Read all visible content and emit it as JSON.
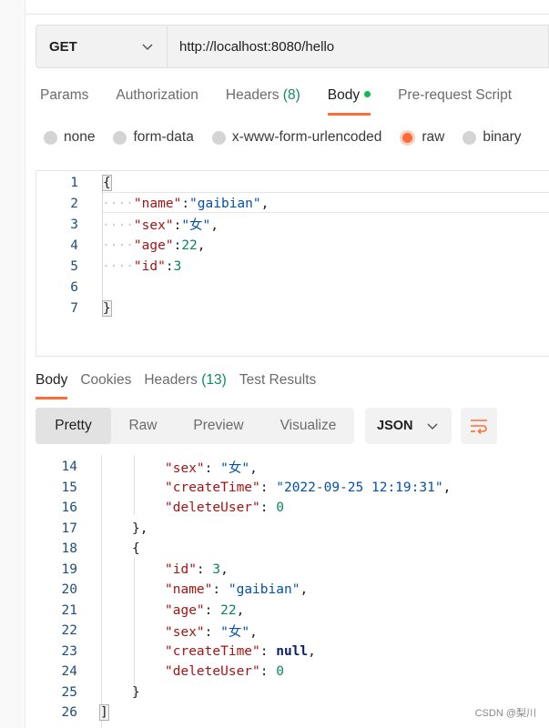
{
  "request": {
    "method": "GET",
    "url": "http://localhost:8080/hello"
  },
  "request_tabs": [
    {
      "label": "Params"
    },
    {
      "label": "Authorization"
    },
    {
      "label": "Headers ",
      "count": "(8)"
    },
    {
      "label": "Body"
    },
    {
      "label": "Pre-request Script"
    }
  ],
  "body_types": [
    "none",
    "form-data",
    "x-www-form-urlencoded",
    "raw",
    "binary"
  ],
  "editor_lines": [
    {
      "n": "1",
      "text": "{"
    },
    {
      "n": "2",
      "indent": "····",
      "key": "\"name\"",
      "sep": ":",
      "value": "\"gaibian\"",
      "end": ","
    },
    {
      "n": "3",
      "indent": "····",
      "key": "\"sex\"",
      "sep": ":",
      "value": "\"女\"",
      "end": ","
    },
    {
      "n": "4",
      "indent": "····",
      "key": "\"age\"",
      "sep": ":",
      "value": "22",
      "end": ","
    },
    {
      "n": "5",
      "indent": "····",
      "key": "\"id\"",
      "sep": ":",
      "value": "3",
      "end": ""
    },
    {
      "n": "6",
      "text": ""
    },
    {
      "n": "7",
      "text": "}"
    }
  ],
  "response_tabs": [
    {
      "label": "Body"
    },
    {
      "label": "Cookies"
    },
    {
      "label": "Headers ",
      "count": "(13)"
    },
    {
      "label": "Test Results"
    }
  ],
  "view_modes": [
    "Pretty",
    "Raw",
    "Preview",
    "Visualize"
  ],
  "format": "JSON",
  "response_lines": [
    {
      "n": "14",
      "key": "\"sex\"",
      "value": "\"女\"",
      "end": ","
    },
    {
      "n": "15",
      "key": "\"createTime\"",
      "value": "\"2022-09-25 12:19:31\"",
      "end": ","
    },
    {
      "n": "16",
      "key": "\"deleteUser\"",
      "value": "0",
      "end": ""
    },
    {
      "n": "17",
      "brace": "},"
    },
    {
      "n": "18",
      "brace": "{"
    },
    {
      "n": "19",
      "key": "\"id\"",
      "value": "3",
      "end": ","
    },
    {
      "n": "20",
      "key": "\"name\"",
      "value": "\"gaibian\"",
      "end": ","
    },
    {
      "n": "21",
      "key": "\"age\"",
      "value": "22",
      "end": ","
    },
    {
      "n": "22",
      "key": "\"sex\"",
      "value": "\"女\"",
      "end": ","
    },
    {
      "n": "23",
      "key": "\"createTime\"",
      "value": "null",
      "end": ","
    },
    {
      "n": "24",
      "key": "\"deleteUser\"",
      "value": "0",
      "end": ""
    },
    {
      "n": "25",
      "brace": "}"
    },
    {
      "n": "26",
      "brace": "]"
    }
  ],
  "watermark": "CSDN @梨川",
  "colors": {
    "accent": "#ff6c37",
    "count": "#0f8a5f",
    "dot": "#0cbb52"
  }
}
